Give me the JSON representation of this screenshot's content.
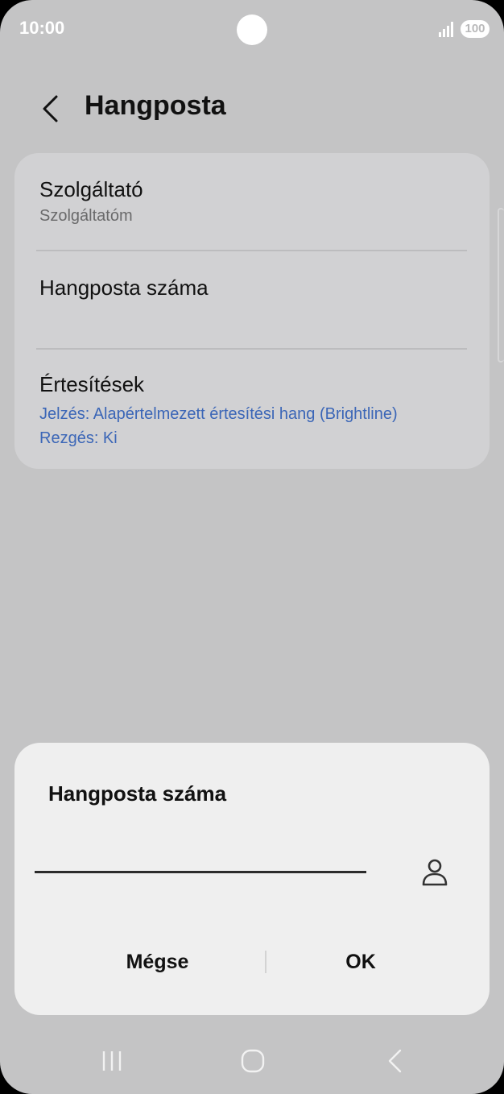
{
  "status_bar": {
    "time": "10:00",
    "battery": "100",
    "icons": [
      "camera-cutout",
      "signal-icon",
      "battery-icon"
    ]
  },
  "header": {
    "back_icon": "chevron-left-icon",
    "title": "Hangposta"
  },
  "settings": {
    "provider": {
      "title": "Szolgáltató",
      "value": "Szolgáltatóm"
    },
    "voicemail_number": {
      "title": "Hangposta száma"
    },
    "notifications": {
      "title": "Értesítések",
      "sound": "Jelzés: Alapértelmezett értesítési hang (Brightline)",
      "vibration": "Rezgés: Ki"
    }
  },
  "dialog": {
    "title": "Hangposta száma",
    "input_value": "",
    "contact_icon": "person-icon",
    "cancel_label": "Mégse",
    "ok_label": "OK"
  },
  "nav_bar": {
    "icons": [
      "recents-icon",
      "home-icon",
      "back-icon"
    ]
  },
  "colors": {
    "background": "#c4c4c5",
    "card": "#d1d1d3",
    "dialog": "#efefef",
    "link_blue": "#3b66b7"
  }
}
